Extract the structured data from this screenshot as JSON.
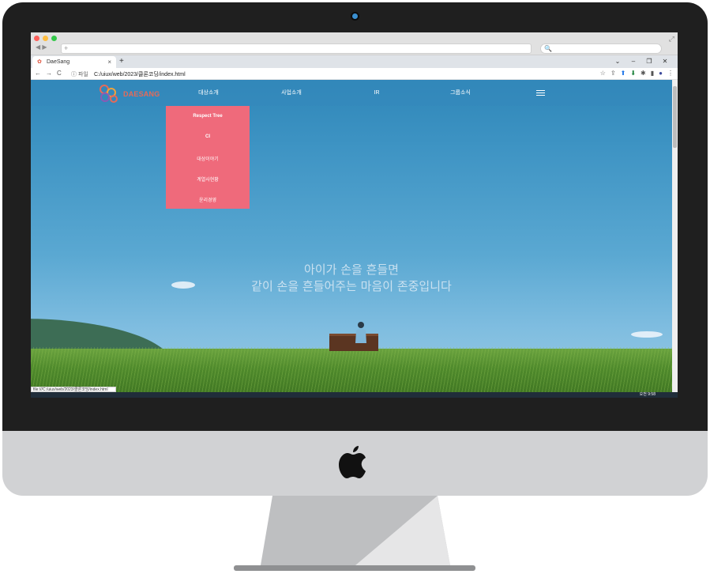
{
  "browser": {
    "mac_bar": {
      "nav_arrows": "◀  ▶",
      "new_tab_symbol": "+"
    },
    "tab": {
      "title": "DaeSang",
      "close": "×",
      "new_tab": "+"
    },
    "window_controls": [
      "⌄",
      "–",
      "❐",
      "✕"
    ],
    "address": {
      "nav": [
        "←",
        "→",
        "C"
      ],
      "info": "ⓘ 파일",
      "url": "C:/uiux/web/2023/클론코딩/index.html"
    },
    "toolbar_icons": [
      "☆",
      "⇪",
      "⬆",
      "⬇",
      "✱",
      "▮",
      "●",
      "⋮"
    ]
  },
  "site": {
    "logo_text": "DAESANG",
    "nav": [
      "대상소개",
      "사업소개",
      "IR",
      "그룹소식"
    ],
    "dropdown": [
      "Respect Tree",
      "CI",
      "대상이야기",
      "계열사현황",
      "윤리경영"
    ],
    "hero_line1": "아이가 손을 흔들면",
    "hero_line2": "같이 손을 흔들어주는 마음이 존중입니다"
  },
  "status_url": "file:///C:/uiux/web/2023/클론코딩/index.html",
  "taskbar_clock": "오전 9:58",
  "colors": {
    "dropdown": "#ef6a7b",
    "sky": "#3d93c3",
    "logo": "#e66a58"
  }
}
